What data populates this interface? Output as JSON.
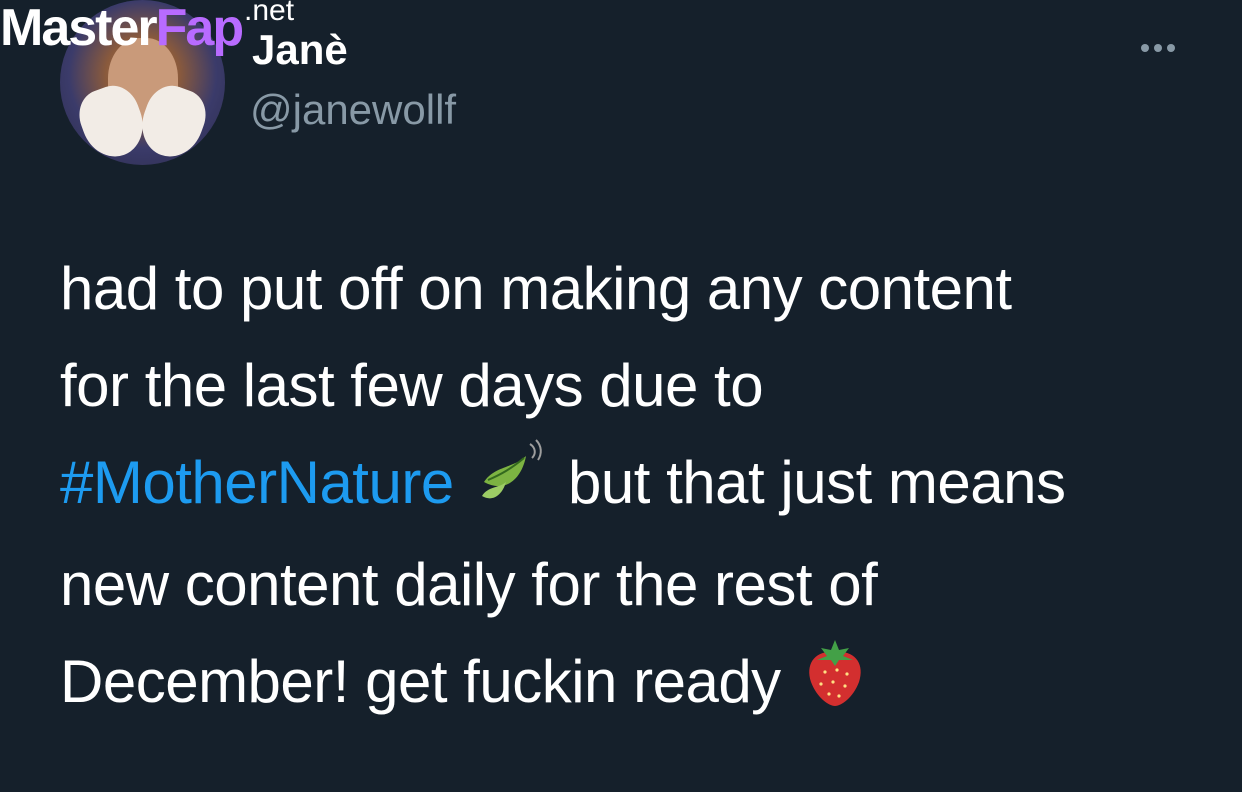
{
  "watermark": {
    "part1": "Master",
    "part2": "Fap",
    "part3": ".net"
  },
  "author": {
    "display_name": "Janè",
    "handle": "@janewollf"
  },
  "tweet": {
    "line1": "had to put off on making any content",
    "line2": "for the last few days due to",
    "hashtag": "#MotherNature",
    "line3_after": "but that just means",
    "line4": "new content daily for the rest of",
    "line5": "December! get fuckin ready",
    "emoji1": "leaf-fluttering-in-wind-emoji",
    "emoji2": "strawberry-emoji"
  },
  "colors": {
    "background": "#15202b",
    "hashtag": "#1d9bf0",
    "secondary": "#8899a6"
  }
}
